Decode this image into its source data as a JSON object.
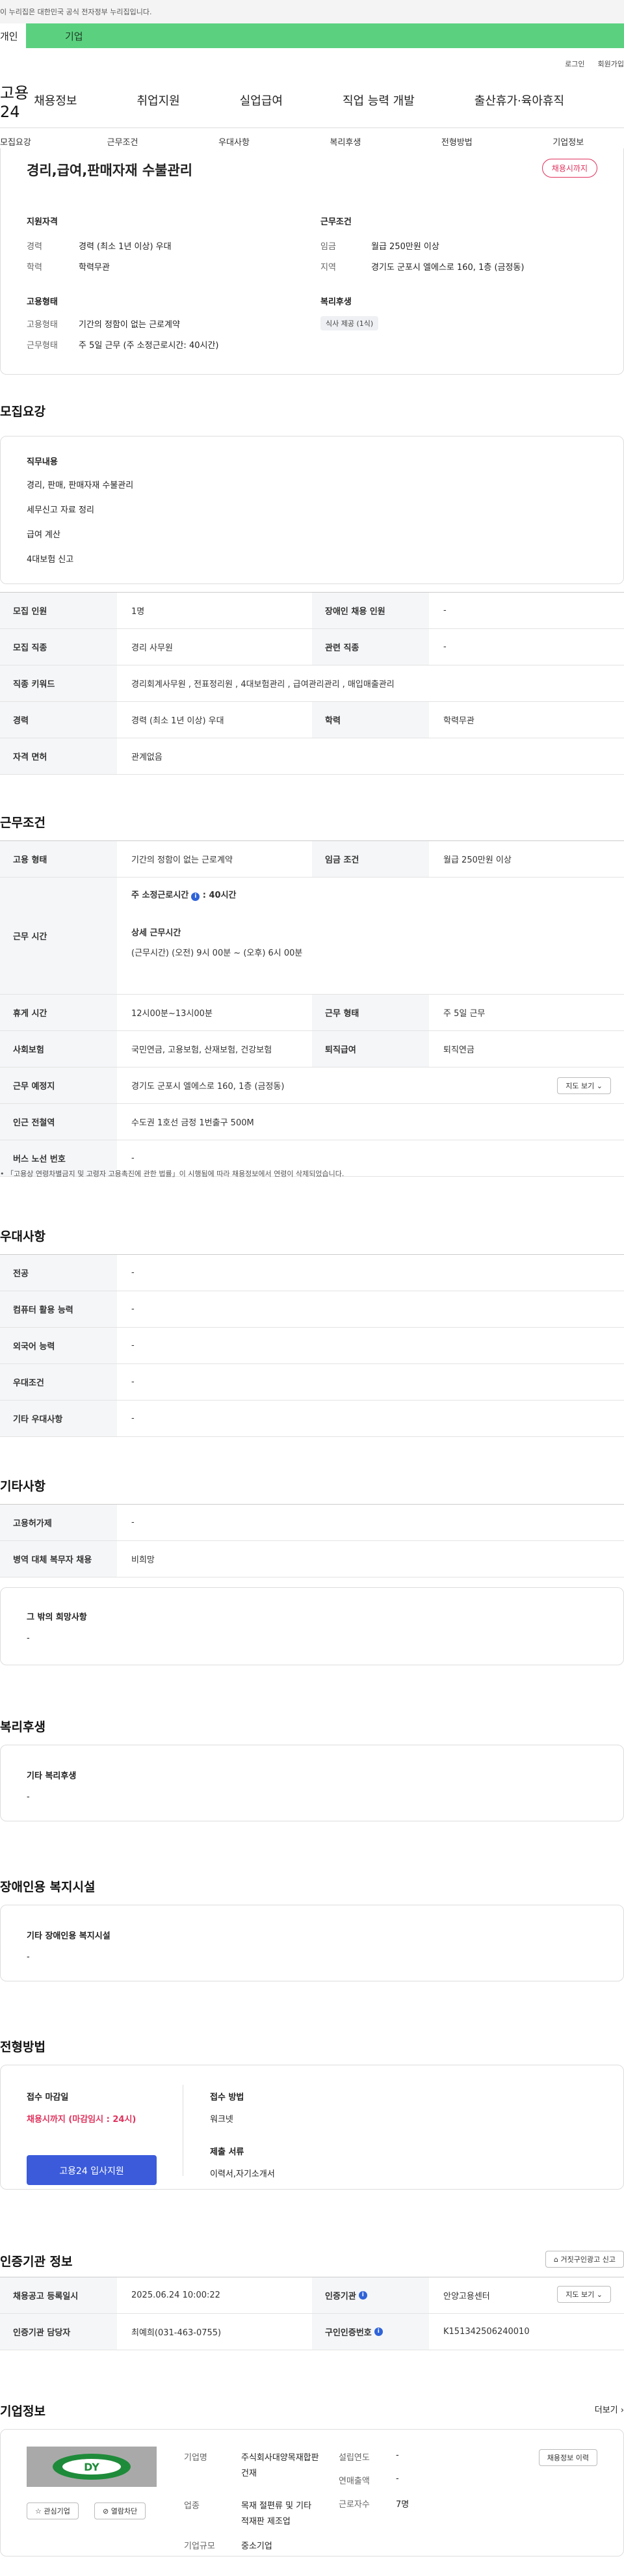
{
  "gov_banner": "이 누리집은 대한민국 공식 전자정부 누리집입니다.",
  "top_tabs": [
    "개인",
    "기업"
  ],
  "util_links": [
    "로그인",
    "회원가입"
  ],
  "logo": "고용24",
  "nav": [
    "채용정보",
    "취업지원",
    "실업급여",
    "직업 능력 개발",
    "출산휴가·육아휴직"
  ],
  "subnav": [
    "모집요강",
    "근무조건",
    "우대사항",
    "복리후생",
    "전형방법",
    "기업정보"
  ],
  "summary": {
    "title": "경리,급여,판매자재 수불관리",
    "badge": "채용시까지",
    "qual_title": "지원자격",
    "career_label": "경력",
    "career_value": "경력 (최소 1년 이상) 우대",
    "edu_label": "학력",
    "edu_value": "학력무관",
    "cond_title": "근무조건",
    "wage_label": "임금",
    "wage_value": "월급 250만원 이상",
    "region_label": "지역",
    "region_value": "경기도 군포시 엘에스로 160, 1층 (금정동)",
    "emp_title": "고용형태",
    "emp_type_label": "고용형태",
    "emp_type_value": "기간의 정함이 없는 근로계약",
    "work_type_label": "근무형태",
    "work_type_value": "주 5일 근무 (주 소정근로시간: 40시간)",
    "welfare_title": "복리후생",
    "welfare_chip": "식사 제공 (1식)"
  },
  "recruit": {
    "title": "모집요강",
    "duty_title": "직무내용",
    "duties": [
      "경리, 판매, 판매자재 수불관리",
      "세무신고 자료 정리",
      "급여 계산",
      "4대보험 신고"
    ],
    "rows": {
      "headcount_label": "모집 인원",
      "headcount_value": "1명",
      "disabled_label": "장애인 채용 인원",
      "disabled_value": "-",
      "job_label": "모집 직종",
      "job_value": "경리 사무원",
      "related_label": "관련 직종",
      "related_value": "-",
      "keyword_label": "직종 키워드",
      "keyword_value": "경리회계사무원 , 전표정리원 , 4대보험관리 , 급여관리관리 , 매입매출관리",
      "career_label": "경력",
      "career_value": "경력 (최소 1년 이상) 우대",
      "edu_label": "학력",
      "edu_value": "학력무관",
      "license_label": "자격 면허",
      "license_value": "관계없음"
    }
  },
  "work": {
    "title": "근무조건",
    "emp_label": "고용 형태",
    "emp_value": "기간의 정함이 없는 근로계약",
    "wage_label": "임금 조건",
    "wage_value": "월급 250만원 이상",
    "hours_label": "근무 시간",
    "weekly_hours": "주 소정근로시간",
    "weekly_hours_value": ": 40시간",
    "detail_title": "상세 근무시간",
    "detail_value": "(근무시간) (오전) 9시 00분 ~ (오후) 6시 00분",
    "rest_label": "휴게 시간",
    "rest_value": "12시00분~13시00분",
    "form_label": "근무 형태",
    "form_value": "주 5일 근무",
    "insurance_label": "사회보험",
    "insurance_value": "국민연금, 고용보험, 산재보험, 건강보험",
    "severance_label": "퇴직급여",
    "severance_value": "퇴직연금",
    "place_label": "근무 예정지",
    "place_value": "경기도 군포시 엘에스로 160, 1층 (금정동)",
    "map_btn": "지도 보기",
    "station_label": "인근 전철역",
    "station_value": "수도권 1호선 금정 1번출구 500M",
    "bus_label": "버스 노선 번호",
    "bus_value": "-",
    "notice": "「고용상 연령차별금지 및 고령자 고용촉진에 관한 법률」이 시행됨에 따라 채용정보에서 연령이 삭제되었습니다."
  },
  "pref": {
    "title": "우대사항",
    "rows": [
      {
        "label": "전공",
        "value": "-"
      },
      {
        "label": "컴퓨터 활용 능력",
        "value": "-"
      },
      {
        "label": "외국어 능력",
        "value": "-"
      },
      {
        "label": "우대조건",
        "value": "-"
      },
      {
        "label": "기타 우대사항",
        "value": "-"
      }
    ]
  },
  "etc": {
    "title": "기타사항",
    "rows": [
      {
        "label": "고용허가제",
        "value": "-"
      },
      {
        "label": "병역 대체 복무자 채용",
        "value": "비희망"
      }
    ],
    "wish_title": "그 밖의 희망사항",
    "wish_value": "-"
  },
  "welfare": {
    "title": "복리후생",
    "sub": "기타 복리후생",
    "value": "-"
  },
  "disabled": {
    "title": "장애인용 복지시설",
    "sub": "기타 장애인용 복지시설",
    "value": "-"
  },
  "screening": {
    "title": "전형방법",
    "deadline_title": "접수 마감일",
    "deadline_value": "채용시까지 (마감임시 : 24시)",
    "apply_btn": "고용24 입사지원",
    "method_title": "접수 방법",
    "method_value": "워크넷",
    "docs_title": "제출 서류",
    "docs_value": "이력서,자기소개서"
  },
  "cert": {
    "title": "인증기관 정보",
    "report_btn": "거짓구인광고 신고",
    "reg_label": "채용공고 등록일시",
    "reg_value": "2025.06.24 10:00:22",
    "org_label": "인증기관",
    "org_value": "안양고용센터",
    "mgr_label": "인증기관 담당자",
    "mgr_value": "최예희(031-463-0755)",
    "num_label": "구인인증번호",
    "num_value": "K151342506240010",
    "map_btn": "지도 보기"
  },
  "company": {
    "title": "기업정보",
    "more": "더보기",
    "logo_text": "DY",
    "fav_btn": "관심기업",
    "block_btn": "열람차단",
    "name_label": "기업명",
    "name_value": "주식회사대양목재합판건재",
    "industry_label": "업종",
    "industry_value": "목재 절편류 및 기타 적재판 제조업",
    "size_label": "기업규모",
    "size_value": "중소기업",
    "founded_label": "설립연도",
    "founded_value": "-",
    "sales_label": "연매출액",
    "sales_value": "-",
    "staff_label": "근로자수",
    "staff_value": "7명",
    "jobs_btn": "채용정보 이력"
  }
}
